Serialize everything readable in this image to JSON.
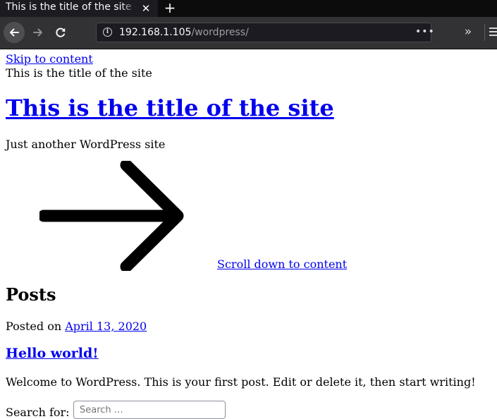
{
  "browser": {
    "tab_title": "This is the title of the site – Just another WordPress site",
    "tab_close_glyph": "✕",
    "new_tab_glyph": "+",
    "url_host": "192.168.1.105",
    "url_path": "/wordpress/",
    "page_actions_glyph": "•••",
    "overflow_glyph": "»",
    "colors": {
      "tabbar": "#0c0c0d",
      "toolbar": "#323234",
      "urlbar": "#1c1b22"
    }
  },
  "page": {
    "skip_link": "Skip to content",
    "site_title_text": "This is the title of the site",
    "site_title": "This is the title of the site",
    "tagline": "Just another WordPress site",
    "scroll_link": "Scroll down to content",
    "posts_heading": "Posts",
    "posted_on_label": "Posted on ",
    "post_date": "April 13, 2020",
    "post_title": "Hello world!",
    "post_excerpt": "Welcome to WordPress. This is your first post. Edit or delete it, then start writing!",
    "search_label": "Search for:",
    "search_placeholder": "Search …",
    "link_color": "#0000ee"
  }
}
